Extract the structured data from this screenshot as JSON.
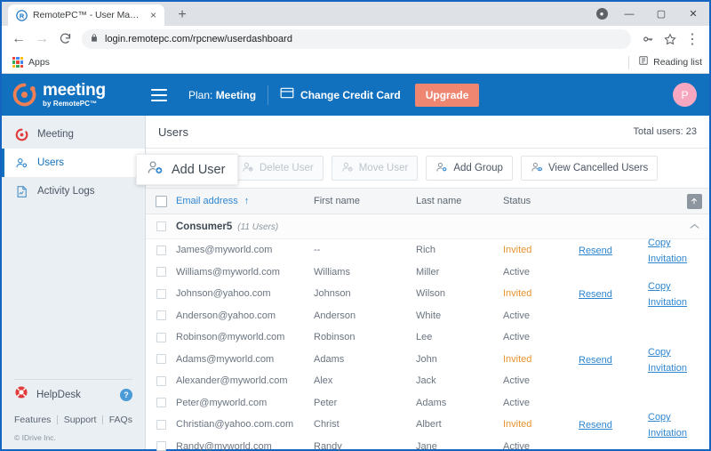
{
  "browser": {
    "tab": {
      "title": "RemotePC™ - User Management",
      "favicon": "remotepc-favicon",
      "close": "×"
    },
    "new_tab": "+",
    "window_controls": {
      "profile": "profile-avatar-icon",
      "minimize": "—",
      "maximize": "▢",
      "close": "✕"
    },
    "nav": {
      "back": "←",
      "forward": "→",
      "reload": "⟳",
      "lock": "lock-icon",
      "url": "login.remotepc.com/rpcnew/userdashboard",
      "key": "key-icon",
      "star": "star-icon",
      "menu": "⋮"
    },
    "bookmarks": {
      "apps_label": "Apps",
      "reading_list": "Reading list"
    }
  },
  "appbar": {
    "logo_main": "meeting",
    "logo_sub": "by RemotePC™",
    "menu_icon": "hamburger-menu-icon",
    "plan_prefix": "Plan: ",
    "plan_value": "Meeting",
    "change_card": "Change Credit Card",
    "upgrade": "Upgrade",
    "avatar_initial": "P",
    "colors": {
      "header_bg": "#1271bf",
      "upgrade_bg": "#ee8672",
      "avatar_bg": "#f7a8c0"
    }
  },
  "sidebar": {
    "items": [
      {
        "label": "Meeting",
        "icon": "meeting-icon",
        "active": false
      },
      {
        "label": "Users",
        "icon": "users-icon",
        "active": true
      },
      {
        "label": "Activity Logs",
        "icon": "activity-logs-icon",
        "active": false
      }
    ],
    "helpdesk": {
      "label": "HelpDesk",
      "icon": "lifering-icon",
      "badge": "?"
    },
    "links": [
      "Features",
      "Support",
      "FAQs"
    ],
    "copyright": "© IDrive Inc."
  },
  "page": {
    "title": "Users",
    "total_users": "Total users: 23"
  },
  "toolbar": {
    "add_user": "Add User",
    "delete_user": "Delete User",
    "move_user": "Move User",
    "add_group": "Add Group",
    "view_cancelled": "View Cancelled Users"
  },
  "table": {
    "headers": {
      "email": "Email address",
      "sort_arrow": "↑",
      "first_name": "First name",
      "last_name": "Last name",
      "status": "Status",
      "export_icon": "export-upload-icon"
    },
    "group": {
      "name": "Consumer5",
      "count": "(11 Users)",
      "collapse_icon": "chevron-up-icon"
    },
    "links": {
      "resend": "Resend",
      "copy": "Copy Invitation"
    },
    "rows": [
      {
        "email": "James@myworld.com",
        "first": "--",
        "last": "Rich",
        "status": "Invited",
        "resend": "Resend",
        "copy": "Copy Invitation"
      },
      {
        "email": "Williams@myworld.com",
        "first": "Williams",
        "last": "Miller",
        "status": "Active",
        "resend": "",
        "copy": ""
      },
      {
        "email": "Johnson@yahoo.com",
        "first": "Johnson",
        "last": "Wilson",
        "status": "Invited",
        "resend": "Resend",
        "copy": "Copy Invitation"
      },
      {
        "email": "Anderson@yahoo.com",
        "first": "Anderson",
        "last": "White",
        "status": "Active",
        "resend": "",
        "copy": ""
      },
      {
        "email": "Robinson@myworld.com",
        "first": "Robinson",
        "last": "Lee",
        "status": "Active",
        "resend": "",
        "copy": ""
      },
      {
        "email": "Adams@myworld.com",
        "first": "Adams",
        "last": "John",
        "status": "Invited",
        "resend": "Resend",
        "copy": "Copy Invitation"
      },
      {
        "email": "Alexander@myworld.com",
        "first": "Alex",
        "last": "Jack",
        "status": "Active",
        "resend": "",
        "copy": ""
      },
      {
        "email": "Peter@myworld.com",
        "first": "Peter",
        "last": "Adams",
        "status": "Active",
        "resend": "",
        "copy": ""
      },
      {
        "email": "Christian@yahoo.com.com",
        "first": "Christ",
        "last": "Albert",
        "status": "Invited",
        "resend": "Resend",
        "copy": "Copy Invitation"
      },
      {
        "email": "Randy@myworld.com",
        "first": "Randy",
        "last": "Jane",
        "status": "Active",
        "resend": "",
        "copy": ""
      }
    ]
  }
}
